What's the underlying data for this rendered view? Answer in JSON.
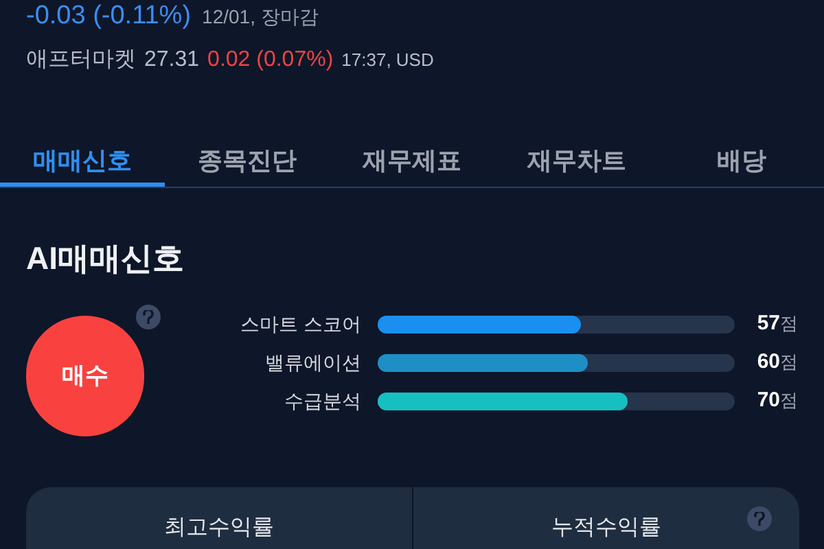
{
  "quote": {
    "change": "-0.03 (-0.11%)",
    "meta": "12/01, 장마감"
  },
  "after_market": {
    "label": "애프터마켓",
    "price": "27.31",
    "change": "0.02 (0.07%)",
    "meta": "17:37, USD"
  },
  "tabs": [
    {
      "label": "매매신호",
      "selected": true
    },
    {
      "label": "종목진단",
      "selected": false
    },
    {
      "label": "재무제표",
      "selected": false
    },
    {
      "label": "재무차트",
      "selected": false
    },
    {
      "label": "배당",
      "selected": false
    }
  ],
  "section": {
    "title": "AI매매신호",
    "signal": {
      "label": "매수",
      "kind": "buy"
    },
    "scores": [
      {
        "name": "스마트 스코어",
        "level": 0.57,
        "color": "#1a8ff0",
        "value": "57",
        "unit": "점"
      },
      {
        "name": "밸류에이션",
        "level": 0.59,
        "color": "#1e8fc4",
        "value": "60",
        "unit": "점"
      },
      {
        "name": "수급분석",
        "level": 0.7,
        "color": "#17c0c0",
        "value": "70",
        "unit": "점"
      }
    ]
  },
  "returns": {
    "columns": [
      "최고수익률",
      "누적수익률"
    ]
  }
}
